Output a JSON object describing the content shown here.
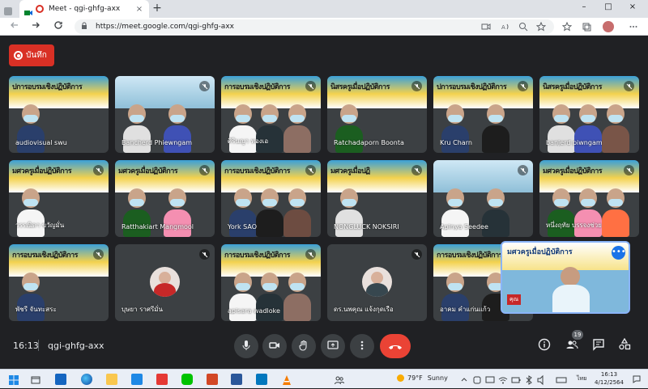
{
  "browser": {
    "tab_title": "Meet - qgi-ghfg-axx",
    "tab_close": "×",
    "new_tab": "+",
    "url": "https://meet.google.com/qgi-ghfg-axx",
    "window_controls": [
      "–",
      "□",
      "×"
    ]
  },
  "recording": {
    "label": "บันทึก",
    "color": "#d93025"
  },
  "tiles": [
    {
      "name": "audiovisual swu",
      "type": "video",
      "banner": "ปการอบรมเชิงปฏิบัติการ",
      "muted": false
    },
    {
      "name": "Bancherd Phiewngam",
      "type": "video",
      "banner": "",
      "muted": true
    },
    {
      "name": "ศิรินญา ทองเอ",
      "type": "video",
      "banner": "การอบรมเชิงปฏิบัติการ",
      "muted": true
    },
    {
      "name": "Ratchadaporn Boonta",
      "type": "video",
      "banner": "นิสรครูเมื่อปฏิบัติการ",
      "muted": true
    },
    {
      "name": "Kru Charn",
      "type": "video",
      "banner": "ปการอบรมเชิงปฏิบัติการ",
      "muted": true
    },
    {
      "name": "banjerd piwngam",
      "type": "video",
      "banner": "นิสรครูเมื่อปฏิบัติการ",
      "muted": true
    },
    {
      "name": "วรรณิดา ขวัญมั่น",
      "type": "video",
      "banner": "มศวครูเมื่อปฏิบัติการ",
      "muted": true
    },
    {
      "name": "Ratthakiart Mangmool",
      "type": "video",
      "banner": "มศวครูเมื่อปฏิบัติการ",
      "muted": true
    },
    {
      "name": "York SAO",
      "type": "video",
      "banner": "การอบรมเชิงปฏิบัติการ",
      "muted": true
    },
    {
      "name": "NONGLUCK NOKSIRI",
      "type": "video",
      "banner": "มศวครูเมื่อปฏิ",
      "muted": true
    },
    {
      "name": "Apinya Seedee",
      "type": "video",
      "banner": "",
      "muted": true
    },
    {
      "name": "หนึ่งฤทัย บรรจงช่วย",
      "type": "video",
      "banner": "มศวครูเมื่อปฏิบัติการ",
      "muted": true
    },
    {
      "name": "พัชรี จันทะสระ",
      "type": "video",
      "banner": "การอบรมเชิงปฏิบัติการ",
      "muted": true
    },
    {
      "name": "บุษยา ราศรีมั่น",
      "type": "avatar",
      "banner": "",
      "muted": true
    },
    {
      "name": "apisara wadloke",
      "type": "video",
      "banner": "การอบรมเชิงปฏิบัติการ",
      "muted": true
    },
    {
      "name": "ดร.นพคุณ แจ้งกุดเรือ",
      "type": "avatar",
      "banner": "",
      "muted": true
    },
    {
      "name": "อาคม คำแก่นแก้ว",
      "type": "video",
      "banner": "การอบรมเชิงปฏิบัติการ",
      "muted": true
    }
  ],
  "self_view": {
    "banner": "มศวครูเมื่อปฏิบัติการ",
    "more": "•••",
    "tag": "คุณ"
  },
  "controls": {
    "time": "16:13",
    "meeting_code": "qgi-ghfg-axx",
    "people_count": "19"
  },
  "taskbar": {
    "temp": "79°F",
    "condition": "Sunny",
    "lang": "ไทย",
    "time": "16:13",
    "date": "4/12/2564"
  }
}
